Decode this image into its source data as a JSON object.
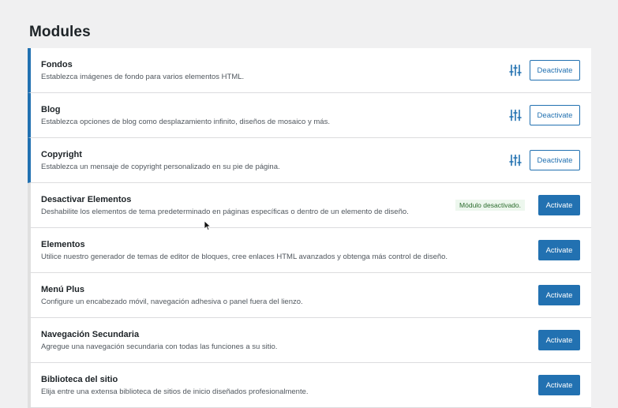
{
  "page": {
    "title": "Modules"
  },
  "modules": [
    {
      "name": "Fondos",
      "description": "Establezca imágenes de fondo para varios elementos HTML.",
      "button_label": "Deactivate",
      "active": true
    },
    {
      "name": "Blog",
      "description": "Establezca opciones de blog como desplazamiento infinito, diseños de mosaico y más.",
      "button_label": "Deactivate",
      "active": true
    },
    {
      "name": "Copyright",
      "description": "Establezca un mensaje de copyright personalizado en su pie de página.",
      "button_label": "Deactivate",
      "active": true
    },
    {
      "name": "Desactivar Elementos",
      "description": "Deshabilite los elementos de tema predeterminado en páginas específicas o dentro de un elemento de diseño.",
      "button_label": "Activate",
      "active": false,
      "status_notice": "Módulo desactivado."
    },
    {
      "name": "Elementos",
      "description": "Utilice nuestro generador de temas de editor de bloques, cree enlaces HTML avanzados y obtenga más control de diseño.",
      "button_label": "Activate",
      "active": false
    },
    {
      "name": "Menú Plus",
      "description": "Configure un encabezado móvil, navegación adhesiva o panel fuera del lienzo.",
      "button_label": "Activate",
      "active": false
    },
    {
      "name": "Navegación Secundaria",
      "description": "Agregue una navegación secundaria con todas las funciones a su sitio.",
      "button_label": "Activate",
      "active": false
    },
    {
      "name": "Biblioteca del sitio",
      "description": "Elija entre una extensa biblioteca de sitios de inicio diseñados profesionalmente.",
      "button_label": "Activate",
      "active": false
    }
  ],
  "icons": {
    "settings": "sliders-icon"
  },
  "colors": {
    "accent": "#2271b1",
    "background": "#f0f0f1",
    "card": "#ffffff",
    "status_text": "#2a6b2c",
    "status_bg": "#edf7ee"
  }
}
